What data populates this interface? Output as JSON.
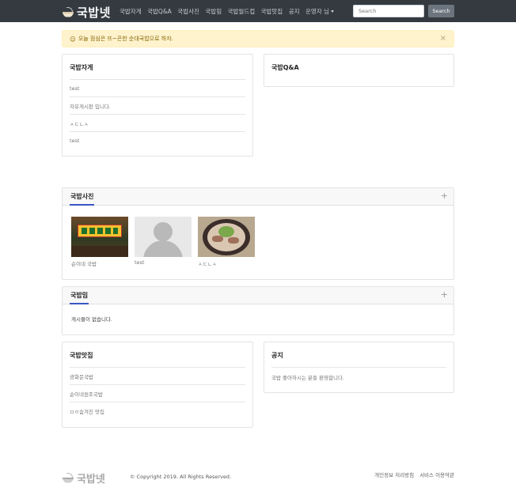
{
  "navbar": {
    "logo_icon": "bowl-icon",
    "brand": "국밥넷",
    "items": [
      "국밥자게",
      "국밥Q&A",
      "국밥사진",
      "국밥밈",
      "국밥월드컵",
      "국밥맛집",
      "공지"
    ],
    "user_menu": "운영자 님",
    "search_placeholder": "Search",
    "search_button": "Search",
    "bg_color": "#343a40"
  },
  "alert": {
    "icon": "smile-icon",
    "smile": "☺",
    "text": "오늘 점심은 뜨~끈한 순대국밥으로 하자.",
    "close": "×",
    "bg_color": "#fff3cd"
  },
  "board_free": {
    "title": "국밥자게",
    "items": [
      "test",
      "자유게시판 입니다.",
      "ㅅㄷㄴㅅ",
      "test"
    ]
  },
  "board_qna": {
    "title": "국밥Q&A",
    "items": []
  },
  "board_photo": {
    "title": "국밥사진",
    "plus": "+",
    "photos": [
      {
        "caption": "순이네 국밥",
        "image": "restaurant-storefront"
      },
      {
        "caption": "test",
        "image": "default-avatar"
      },
      {
        "caption": "ㅅㄷㄴㅅ",
        "image": "gukbap-bowl"
      }
    ]
  },
  "board_meme": {
    "title": "국밥밈",
    "plus": "+",
    "empty_text": "게시물이 없습니다."
  },
  "board_restaurant": {
    "title": "국밥맛집",
    "items": [
      "광화문국밥",
      "순이네원조국밥",
      "ㅁㅇ숨겨진 맛집"
    ]
  },
  "board_notice": {
    "title": "공지",
    "items": [
      "국밥 좋아하시는 분들 환영합니다."
    ]
  },
  "footer": {
    "brand": "국밥넷",
    "copyright": "© Copyright 2019. All Rights Reserved.",
    "links": [
      "개인정보 처리방침",
      "서비스 이용약관"
    ]
  },
  "accent_color": "#3a56c4"
}
